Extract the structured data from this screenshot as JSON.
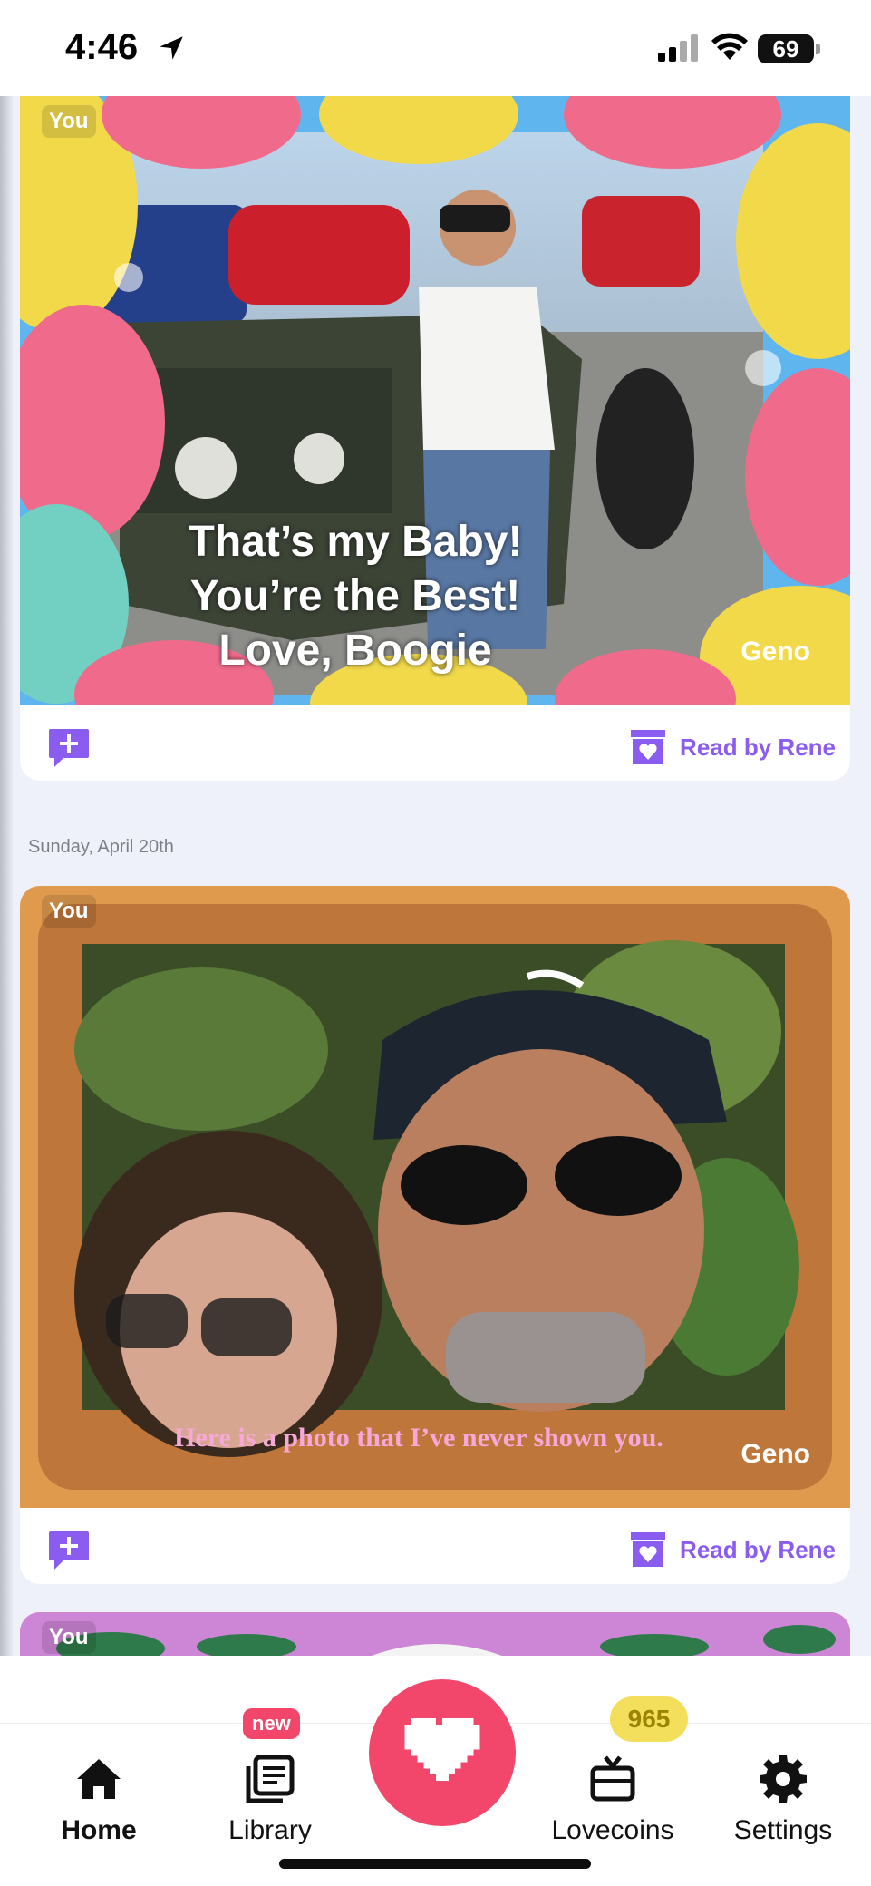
{
  "status_bar": {
    "time": "4:46",
    "battery": "69",
    "icons": [
      "location-arrow-icon",
      "signal-icon",
      "wifi-icon",
      "battery-icon"
    ]
  },
  "cards": [
    {
      "sender": "You",
      "message": "That’s my Baby! You’re the Best! Love, Boogie",
      "author": "Geno",
      "read_status": "Read by Rene",
      "theme": "easter-eggs"
    },
    {
      "date": "Sunday, April 20th",
      "sender": "You",
      "message": "Here is a photo that I’ve never shown you.",
      "author": "Geno",
      "read_status": "Read by Rene",
      "theme": "wood-frame"
    },
    {
      "sender": "You",
      "theme": "purple-leaves"
    }
  ],
  "tab_bar": {
    "home": "Home",
    "library": "Library",
    "library_badge": "new",
    "lovecoins": "Lovecoins",
    "lovecoins_count": "965",
    "settings": "Settings"
  },
  "colors": {
    "accent_purple": "#8a5cf0",
    "love_pink": "#f2476b",
    "coin_yellow": "#f3df5c",
    "background": "#eef1fa"
  }
}
